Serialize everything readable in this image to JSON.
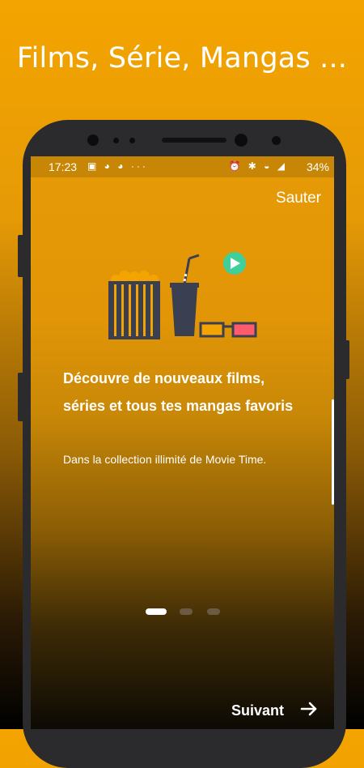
{
  "headline": "Films, Série, Mangas ...",
  "status_bar": {
    "time": "17:23",
    "left_icons": "▣ ◕ ◕ ···",
    "right_icons": "⏰ ✱ ◒ ◢",
    "battery": "34%"
  },
  "onboarding": {
    "skip_label": "Sauter",
    "title": "Découvre de nouveaux films, séries et tous tes mangas favoris",
    "subtitle": "Dans la collection illimité de Movie Time.",
    "next_label": "Suivant",
    "page_index": 1,
    "page_count": 3
  },
  "colors": {
    "accent": "#f4a400",
    "play_button": "#3fcf9a",
    "illustration_dark": "#3b3f52",
    "glasses_orange": "#f4a400",
    "glasses_pink": "#ff5b6e"
  },
  "icons": {
    "play": "play-icon",
    "next": "arrow-right-icon",
    "popcorn": "popcorn-icon",
    "drink": "drink-icon",
    "glasses": "3d-glasses-icon"
  }
}
